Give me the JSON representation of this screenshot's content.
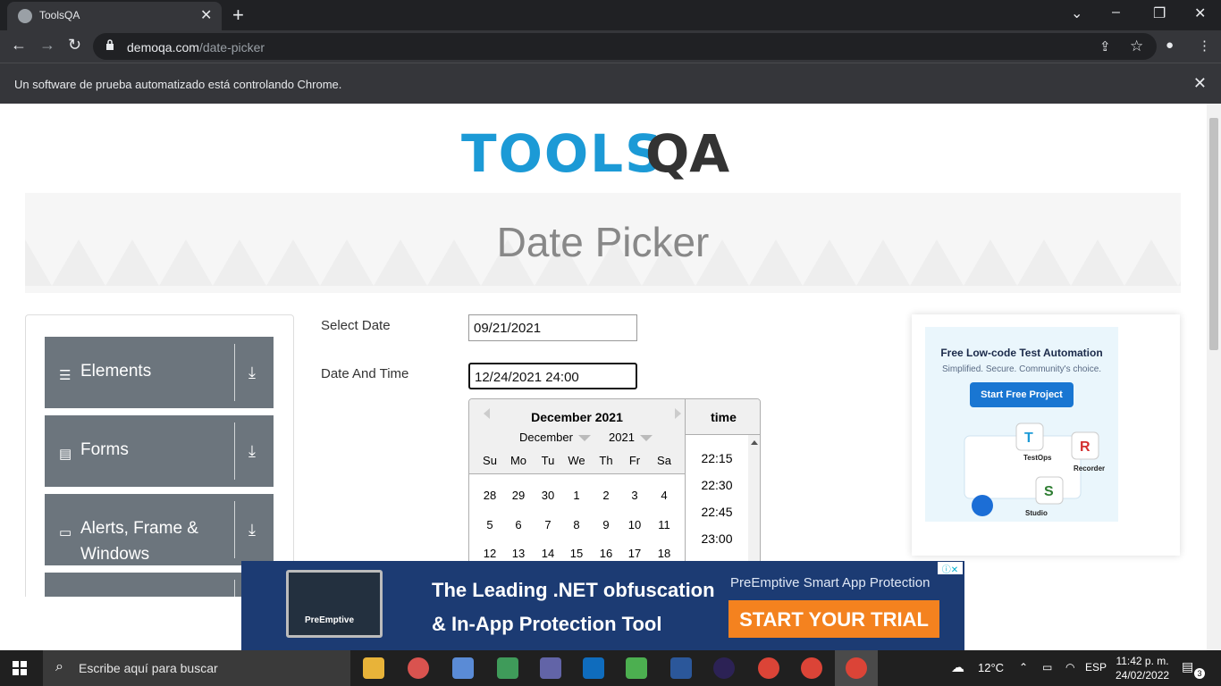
{
  "browser": {
    "tab_title": "ToolsQA",
    "tab_close": "✕",
    "new_tab": "+",
    "url_host": "demoqa.com",
    "url_path": "/date-picker",
    "infobar_message": "Un software de prueba automatizado está controlando Chrome.",
    "infobar_close": "✕",
    "nav": {
      "back": "←",
      "forward": "→",
      "reload": "↻"
    },
    "window_controls": {
      "tab_search": "⌄",
      "minimize": "–",
      "restore": "❐",
      "close": "✕"
    },
    "toolbar_icons": {
      "share": "⇪",
      "bookmark": "☆",
      "profile": "●",
      "menu": "⋮"
    }
  },
  "site": {
    "logo_tools": "TOOLS",
    "logo_qa": "QA",
    "page_title": "Date Picker"
  },
  "sidebar": {
    "groups": [
      {
        "label": "Elements",
        "icon": "☰"
      },
      {
        "label": "Forms",
        "icon": "▤"
      },
      {
        "label": "Alerts, Frame & Windows",
        "icon": "▭"
      }
    ],
    "download_glyph": "⤓"
  },
  "form": {
    "select_date_label": "Select Date",
    "select_date_value": "09/21/2021",
    "date_time_label": "Date And Time",
    "date_time_value": "12/24/2021 24:00"
  },
  "datepicker": {
    "month_title": "December 2021",
    "month_select": "December",
    "year_select": "2021",
    "weekdays": [
      "Su",
      "Mo",
      "Tu",
      "We",
      "Th",
      "Fr",
      "Sa"
    ],
    "weeks": [
      [
        "28",
        "29",
        "30",
        "1",
        "2",
        "3",
        "4"
      ],
      [
        "5",
        "6",
        "7",
        "8",
        "9",
        "10",
        "11"
      ],
      [
        "12",
        "13",
        "14",
        "15",
        "16",
        "17",
        "18"
      ]
    ],
    "time_header": "time",
    "times": [
      "22:15",
      "22:30",
      "22:45",
      "23:00"
    ]
  },
  "ad_right": {
    "headline": "Free Low-code Test Automation",
    "subline": "Simplified. Secure. Community's choice.",
    "button": "Start Free Project",
    "products": [
      "TestOps",
      "Recorder",
      "Studio"
    ]
  },
  "ad_bottom": {
    "line1": "The Leading .NET obfuscation",
    "line2": "& In-App Protection Tool",
    "subtitle": "PreEmptive Smart App Protection",
    "cta": "START YOUR TRIAL",
    "brand": "PreEmptive"
  },
  "taskbar": {
    "search_placeholder": "Escribe aquí para buscar",
    "weather": "12°C",
    "language": "ESP",
    "time": "11:42 p. m.",
    "date": "24/02/2022",
    "notifications": "3"
  }
}
